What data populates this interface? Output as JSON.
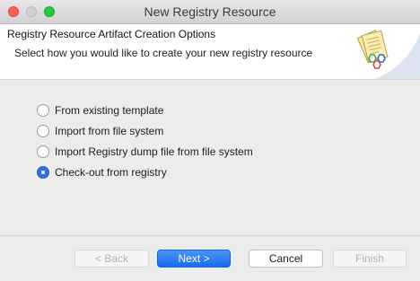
{
  "window": {
    "title": "New Registry Resource",
    "controls": {
      "close": "close-icon",
      "minimize": "minimize-icon",
      "maximize": "maximize-icon"
    }
  },
  "header": {
    "title": "Registry Resource Artifact Creation Options",
    "description": "Select how you would like to create your new registry resource",
    "icon": "registry-documents-icon"
  },
  "options": [
    {
      "label": "From existing template",
      "checked": false
    },
    {
      "label": "Import from file system",
      "checked": false
    },
    {
      "label": "Import Registry dump file from file system",
      "checked": false
    },
    {
      "label": "Check-out from registry",
      "checked": true
    }
  ],
  "buttons": {
    "back": {
      "label": "< Back",
      "enabled": false
    },
    "next": {
      "label": "Next >",
      "enabled": true
    },
    "cancel": {
      "label": "Cancel",
      "enabled": true
    },
    "finish": {
      "label": "Finish",
      "enabled": false
    }
  },
  "colors": {
    "accent": "#2f6fe0",
    "close": "#fe5f57",
    "maximize": "#2ac840"
  }
}
